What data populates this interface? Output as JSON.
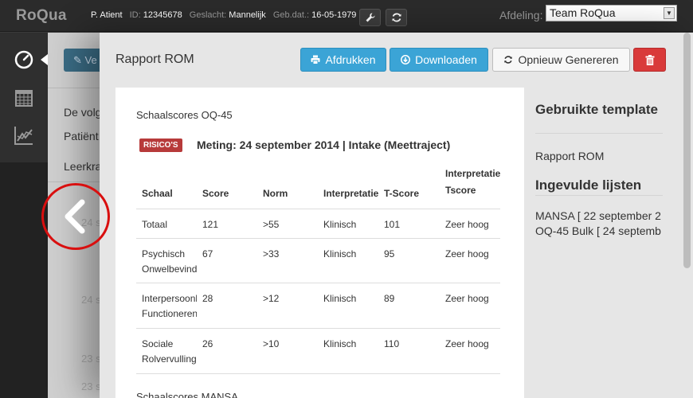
{
  "topbar": {
    "brand": "RoQua",
    "patient_name": "P. Atient",
    "id_label": "ID:",
    "id_value": "12345678",
    "gender_label": "Geslacht:",
    "gender_value": "Mannelijk",
    "dob_label": "Geb.dat.:",
    "dob_value": "16-05-1979",
    "department_label": "Afdeling:",
    "department_value": "Team RoQua"
  },
  "background": {
    "edit_label": "Ve",
    "line1": "De volg",
    "line2": "Patiënt",
    "line3": "Leerkra",
    "dates": [
      "24 s",
      "24 s",
      "23 s",
      "23 s"
    ]
  },
  "modal": {
    "title": "Rapport ROM",
    "print_label": "Afdrukken",
    "download_label": "Downloaden",
    "regenerate_label": "Opnieuw Genereren",
    "section_title": "Schaalscores OQ-45",
    "risk_badge": "RISICO'S",
    "measurement": "Meting: 24 september 2014 | Intake (Meettraject)",
    "next_section": "Schaalscores MANSA",
    "table": {
      "headers": [
        "Schaal",
        "Score",
        "Norm",
        "Interpretatie",
        "T-Score",
        "Interpretatie Tscore"
      ],
      "rows": [
        [
          "Totaal",
          "121",
          ">55",
          "Klinisch",
          "101",
          "Zeer hoog"
        ],
        [
          "Psychisch Onwelbevinden",
          "67",
          ">33",
          "Klinisch",
          "95",
          "Zeer hoog"
        ],
        [
          "Interpersoonlijk Functioneren",
          "28",
          ">12",
          "Klinisch",
          "89",
          "Zeer hoog"
        ],
        [
          "Sociale Rolvervulling",
          "26",
          ">10",
          "Klinisch",
          "110",
          "Zeer hoog"
        ]
      ]
    },
    "sidebar": {
      "template_heading": "Gebruikte template",
      "template_value": "Rapport ROM",
      "lists_heading": "Ingevulde lijsten",
      "lists": [
        "MANSA [ 22 september 2",
        "OQ-45 Bulk [ 24 septemb"
      ]
    }
  },
  "colors": {
    "primary_button": "#3ba4d6",
    "danger_button": "#d93a3a",
    "risk_badge": "#b73a3a",
    "highlight_circle": "#d90f0f"
  }
}
